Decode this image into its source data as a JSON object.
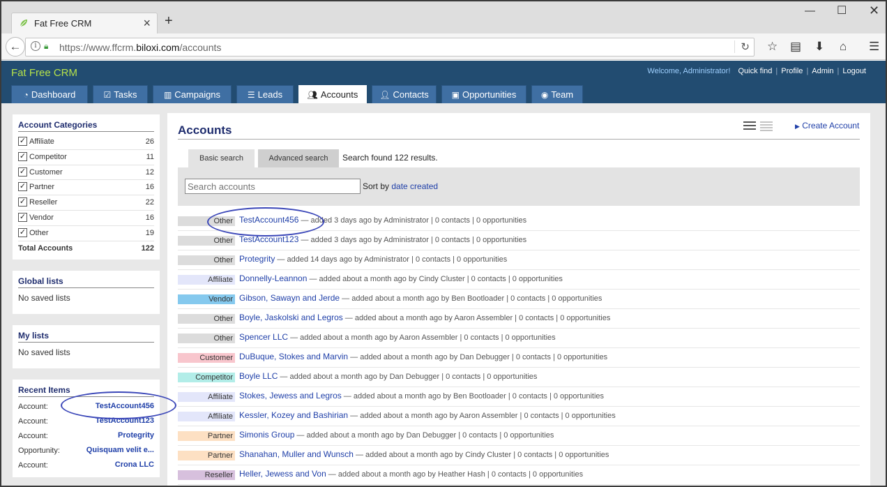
{
  "browser": {
    "tab_title": "Fat Free CRM",
    "url_prefix": "https://www.ffcrm.",
    "url_domain": "biloxi.com",
    "url_path": "/accounts"
  },
  "app": {
    "brand": "Fat Free CRM",
    "welcome": "Welcome, Administrator!",
    "links": [
      "Quick find",
      "Profile",
      "Admin",
      "Logout"
    ],
    "tabs": [
      {
        "label": "Dashboard",
        "icon": "dashboard-icon"
      },
      {
        "label": "Tasks",
        "icon": "checkbox-icon"
      },
      {
        "label": "Campaigns",
        "icon": "bar-chart-icon"
      },
      {
        "label": "Leads",
        "icon": "list-icon"
      },
      {
        "label": "Accounts",
        "icon": "group-icon"
      },
      {
        "label": "Contacts",
        "icon": "user-icon"
      },
      {
        "label": "Opportunities",
        "icon": "money-icon"
      },
      {
        "label": "Team",
        "icon": "globe-icon"
      }
    ]
  },
  "sidebar": {
    "categories_title": "Account Categories",
    "categories": [
      {
        "label": "Affiliate",
        "count": "26"
      },
      {
        "label": "Competitor",
        "count": "11"
      },
      {
        "label": "Customer",
        "count": "12"
      },
      {
        "label": "Partner",
        "count": "16"
      },
      {
        "label": "Reseller",
        "count": "22"
      },
      {
        "label": "Vendor",
        "count": "16"
      },
      {
        "label": "Other",
        "count": "19"
      }
    ],
    "total_label": "Total Accounts",
    "total_count": "122",
    "global_lists_title": "Global lists",
    "global_lists_empty": "No saved lists",
    "my_lists_title": "My lists",
    "my_lists_empty": "No saved lists",
    "recent_title": "Recent Items",
    "recent": [
      {
        "kind": "Account:",
        "name": "TestAccount456"
      },
      {
        "kind": "Account:",
        "name": "TestAccount123"
      },
      {
        "kind": "Account:",
        "name": "Protegrity"
      },
      {
        "kind": "Opportunity:",
        "name": "Quisquam velit e..."
      },
      {
        "kind": "Account:",
        "name": "Crona LLC"
      }
    ]
  },
  "main": {
    "title": "Accounts",
    "create_label": "Create Account",
    "basic_search": "Basic search",
    "advanced_search": "Advanced search",
    "found_text": "Search found 122 results.",
    "search_placeholder": "Search accounts",
    "sort_prefix": "Sort by",
    "sort_value": "date created",
    "accounts": [
      {
        "category": "Other",
        "name": "TestAccount456",
        "meta": " — added 3 days ago by Administrator | 0 contacts | 0 opportunities",
        "color": "#dcdcdc"
      },
      {
        "category": "Other",
        "name": "TestAccount123",
        "meta": " — added 3 days ago by Administrator | 0 contacts | 0 opportunities",
        "color": "#dcdcdc"
      },
      {
        "category": "Other",
        "name": "Protegrity",
        "meta": " — added 14 days ago by Administrator | 0 contacts | 0 opportunities",
        "color": "#dcdcdc"
      },
      {
        "category": "Affiliate",
        "name": "Donnelly-Leannon",
        "meta": " — added about a month ago by Cindy Cluster | 0 contacts | 0 opportunities",
        "color": "#e3e6fa"
      },
      {
        "category": "Vendor",
        "name": "Gibson, Sawayn and Jerde",
        "meta": " — added about a month ago by Ben Bootloader | 0 contacts | 0 opportunities",
        "color": "#85c9ee"
      },
      {
        "category": "Other",
        "name": "Boyle, Jaskolski and Legros",
        "meta": " — added about a month ago by Aaron Assembler | 0 contacts | 0 opportunities",
        "color": "#dcdcdc"
      },
      {
        "category": "Other",
        "name": "Spencer LLC",
        "meta": " — added about a month ago by Aaron Assembler | 0 contacts | 0 opportunities",
        "color": "#dcdcdc"
      },
      {
        "category": "Customer",
        "name": "DuBuque, Stokes and Marvin",
        "meta": " — added about a month ago by Dan Debugger | 0 contacts | 0 opportunities",
        "color": "#f8c6cd"
      },
      {
        "category": "Competitor",
        "name": "Boyle LLC",
        "meta": " — added about a month ago by Dan Debugger | 0 contacts | 0 opportunities",
        "color": "#b2ede8"
      },
      {
        "category": "Affiliate",
        "name": "Stokes, Jewess and Legros",
        "meta": " — added about a month ago by Ben Bootloader | 0 contacts | 0 opportunities",
        "color": "#e3e6fa"
      },
      {
        "category": "Affiliate",
        "name": "Kessler, Kozey and Bashirian",
        "meta": " — added about a month ago by Aaron Assembler | 0 contacts | 0 opportunities",
        "color": "#e3e6fa"
      },
      {
        "category": "Partner",
        "name": "Simonis Group",
        "meta": " — added about a month ago by Dan Debugger | 0 contacts | 0 opportunities",
        "color": "#fde0c3"
      },
      {
        "category": "Partner",
        "name": "Shanahan, Muller and Wunsch",
        "meta": " — added about a month ago by Cindy Cluster | 0 contacts | 0 opportunities",
        "color": "#fde0c3"
      },
      {
        "category": "Reseller",
        "name": "Heller, Jewess and Von",
        "meta": " — added about a month ago by Heather Hash | 0 contacts | 0 opportunities",
        "color": "#d7c0dd"
      }
    ]
  }
}
